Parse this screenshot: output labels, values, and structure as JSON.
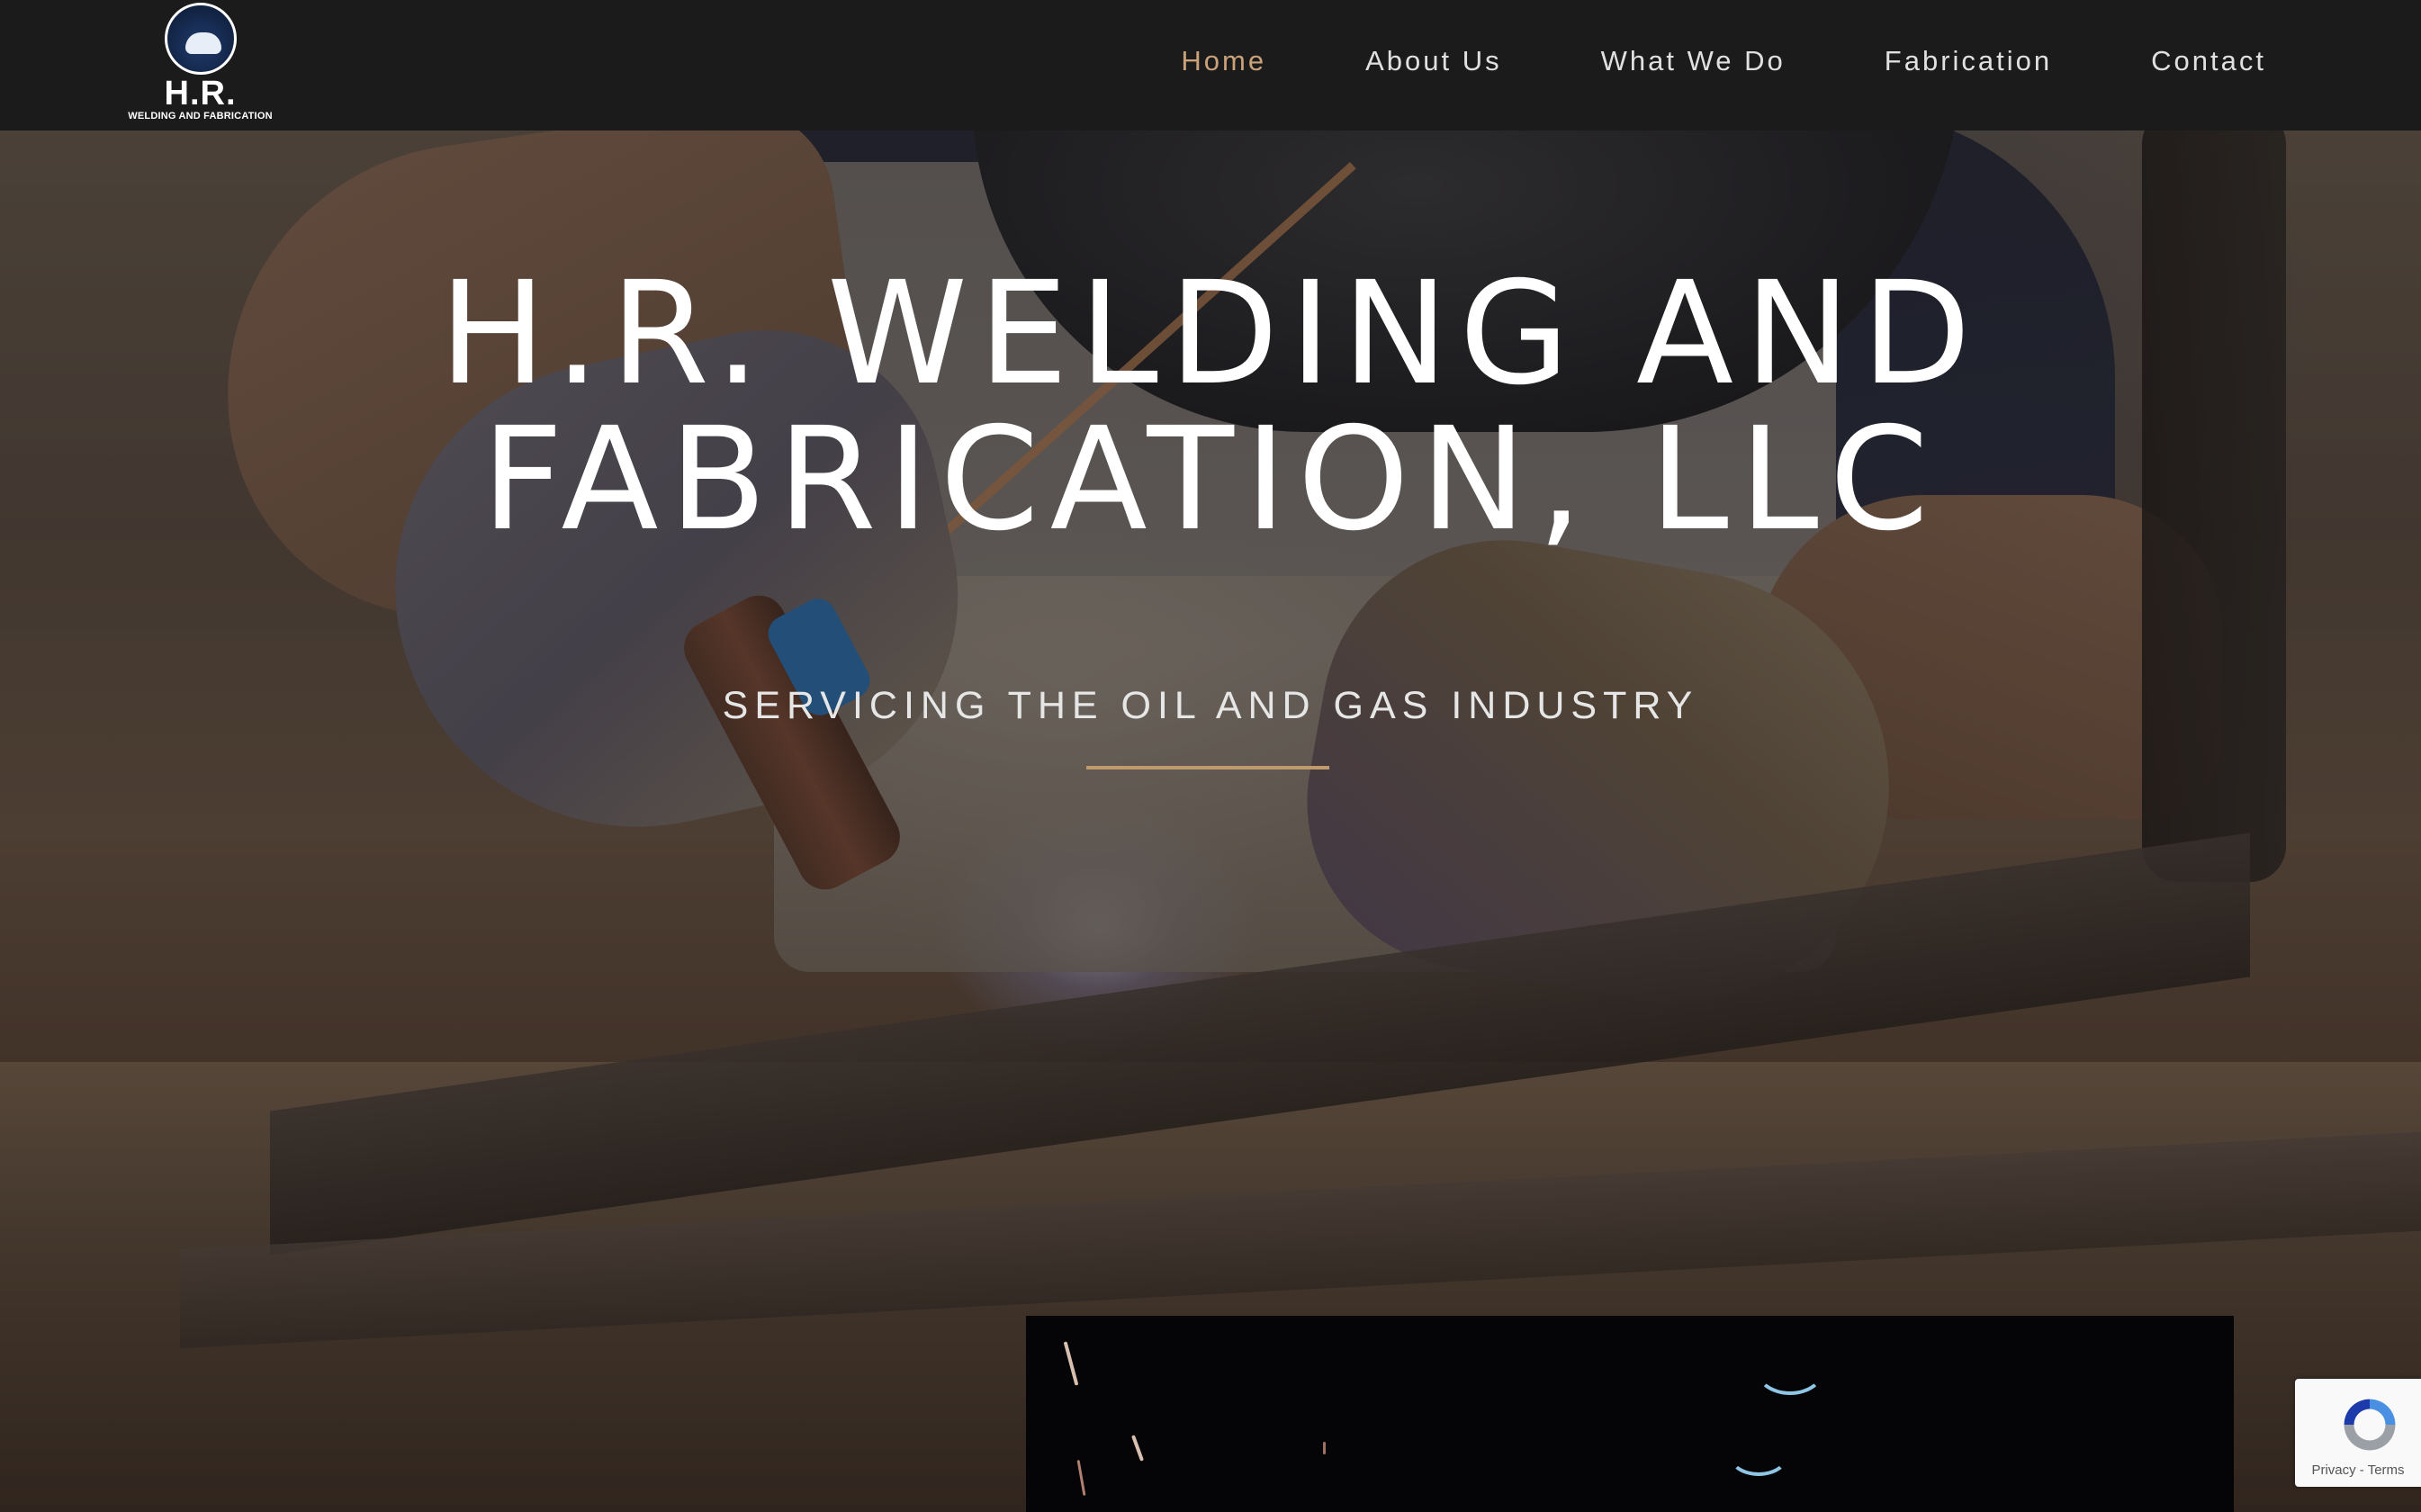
{
  "brand": {
    "logo_text": "H.R.",
    "logo_subtext": "WELDING AND FABRICATION"
  },
  "nav": {
    "items": [
      {
        "label": "Home",
        "active": true
      },
      {
        "label": "About Us",
        "active": false
      },
      {
        "label": "What We Do",
        "active": false
      },
      {
        "label": "Fabrication",
        "active": false
      },
      {
        "label": "Contact",
        "active": false
      }
    ]
  },
  "hero": {
    "title_line1": "H.R. WELDING AND",
    "title_line2": "FABRICATION, LLC",
    "subtitle": "SERVICING THE OIL AND GAS INDUSTRY"
  },
  "recaptcha": {
    "privacy": "Privacy",
    "separator": " - ",
    "terms": "Terms"
  },
  "colors": {
    "header_bg": "#1b1b1b",
    "nav_active": "#c9a27a",
    "nav_text": "#e0e0e0",
    "accent_rule": "#c09a6c"
  }
}
